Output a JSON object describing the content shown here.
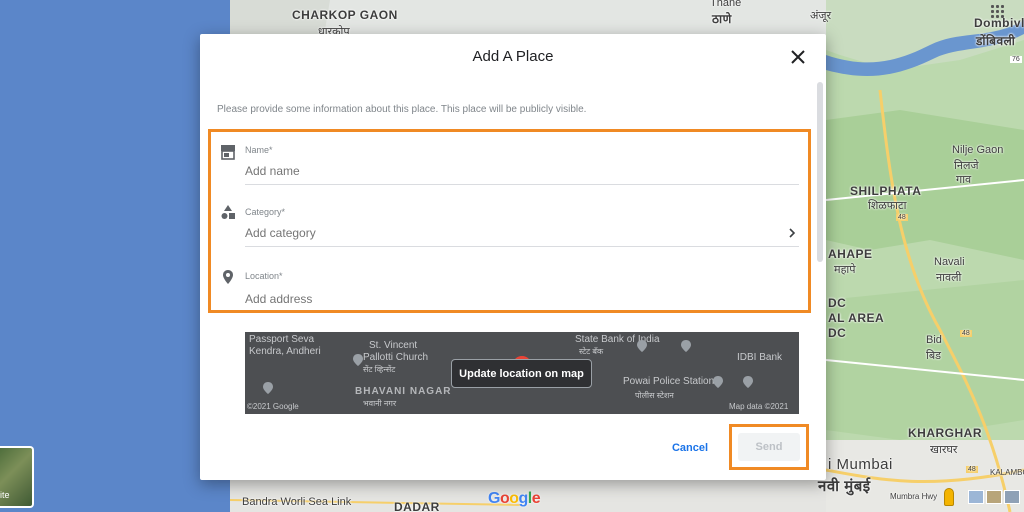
{
  "dialog": {
    "title": "Add A Place",
    "intro": "Please provide some information about this place. This place will be publicly visible.",
    "fields": [
      {
        "label": "Name*",
        "placeholder": "Add name"
      },
      {
        "label": "Category*",
        "placeholder": "Add category"
      },
      {
        "label": "Location*",
        "placeholder": "Add address"
      }
    ],
    "update_location_label": "Update location on map",
    "cancel_label": "Cancel",
    "send_label": "Send"
  },
  "mini_map": {
    "labels": [
      "Passport Seva",
      "Kendra, Andheri",
      "St. Vincent",
      "Pallotti Church",
      "State Bank of India",
      "IDBI Bank",
      "Powai Police Station",
      "BHAVANI NAGAR",
      "©2021 Google",
      "Map data ©2021"
    ],
    "devanagari": [
      "सेंट व्हिन्सेंट",
      "भवानी नगर",
      "स्टेट बँक",
      "पोलीस स्टेशन"
    ]
  },
  "map": {
    "labels": [
      "CHARKOP GAON",
      "धारकोप",
      "Thane",
      "ठाणे",
      "अंजूर",
      "Dombivli",
      "डोंबिवली",
      "Nilje Gaon",
      "निलजे",
      "गाव",
      "SHILPHATA",
      "शिळफाटा",
      "AHAPE",
      "महापे",
      "Navali",
      "नावली",
      "DC",
      "AL AREA",
      "DC",
      "Bid",
      "बिड",
      "KHARGHAR",
      "खारघर",
      "i Mumbai",
      "नवी मुंबई",
      "Bandra Worli Sea Link",
      "DADAR",
      "Mumbra Hwy",
      "KALAMBOLI"
    ],
    "satellite_label": "ite",
    "google_logo": [
      "G",
      "o",
      "o",
      "g",
      "l",
      "e"
    ],
    "road_shields": [
      "76",
      "48",
      "48",
      "48"
    ]
  },
  "colors": {
    "accent": "#1a73e8",
    "highlight": "#f08a24",
    "water": "#5b86c9"
  },
  "icons": {
    "close": "close-icon",
    "name": "store-icon",
    "category": "category-shapes-icon",
    "location": "location-pin-icon",
    "chevron": "chevron-right-icon"
  }
}
